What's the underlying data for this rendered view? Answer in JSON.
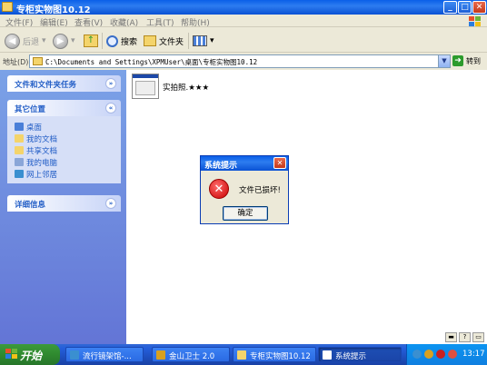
{
  "window": {
    "title": "专柜实物图10.12",
    "buttons": {
      "minimize": "_",
      "maximize": "□",
      "close": "✕"
    }
  },
  "menu": [
    "文件(F)",
    "编辑(E)",
    "查看(V)",
    "收藏(A)",
    "工具(T)",
    "帮助(H)"
  ],
  "toolbar": {
    "back": "后退",
    "search": "搜索",
    "folders": "文件夹"
  },
  "address": {
    "label": "地址(D)",
    "path": "C:\\Documents and Settings\\XPMUser\\桌面\\专柜实物图10.12",
    "go": "转到"
  },
  "taskpane": {
    "file_tasks": "文件和文件夹任务",
    "other_places": {
      "title": "其它位置",
      "items": [
        {
          "label": "桌面",
          "icon": "desktop-icon",
          "color": "#4a7fd8"
        },
        {
          "label": "我的文档",
          "icon": "my-documents-icon",
          "color": "#f4d46b"
        },
        {
          "label": "共享文档",
          "icon": "shared-documents-icon",
          "color": "#f4d46b"
        },
        {
          "label": "我的电脑",
          "icon": "my-computer-icon",
          "color": "#8aa6d8"
        },
        {
          "label": "网上邻居",
          "icon": "network-places-icon",
          "color": "#3a8fd0"
        }
      ]
    },
    "details": "详细信息"
  },
  "files": [
    {
      "name": "实拍照.★★★"
    }
  ],
  "dialog": {
    "title": "系统提示",
    "message": "文件已损坏!",
    "ok": "确定",
    "close": "✕",
    "icon": "error-icon"
  },
  "taskbar": {
    "start": "开始",
    "tasks": [
      {
        "label": "流行镜架馆-...",
        "color": "#3a8fd0"
      },
      {
        "label": "金山卫士 2.0",
        "color": "#d8a020"
      },
      {
        "label": "专柜实物图10.12",
        "color": "#f4d46b"
      },
      {
        "label": "系统提示",
        "color": "#ffffff"
      }
    ],
    "clock": "13:17"
  },
  "colors": {
    "titlebar": "#0a5fe8",
    "taskpane": "#7ba2e7",
    "link": "#215dc6",
    "start": "#3c9a3c"
  }
}
